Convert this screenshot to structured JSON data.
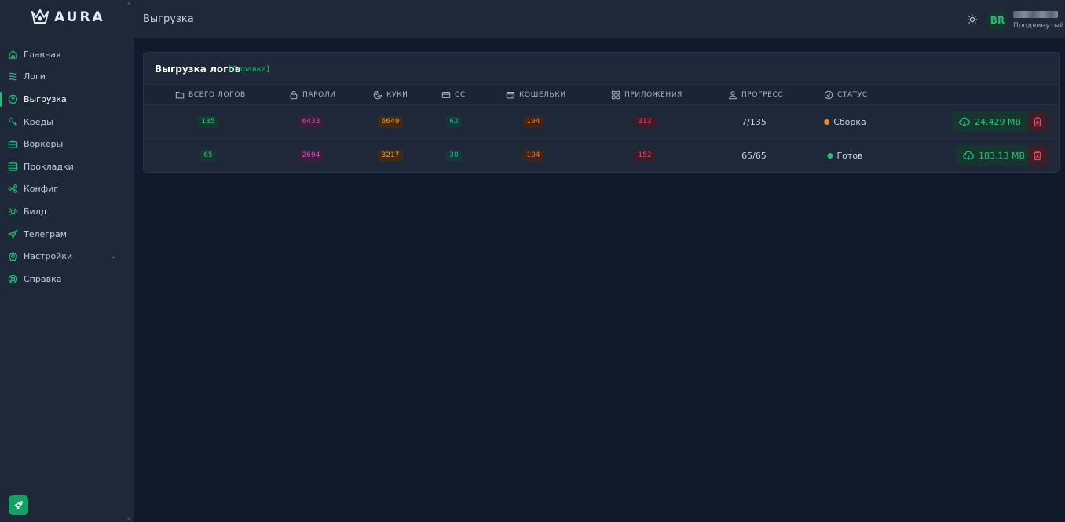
{
  "app": {
    "logo_text": "AURA"
  },
  "sidebar": {
    "items": [
      {
        "label": "Главная",
        "icon": "home-icon"
      },
      {
        "label": "Логи",
        "icon": "logs-icon"
      },
      {
        "label": "Выгрузка",
        "icon": "upload-icon",
        "active": true
      },
      {
        "label": "Креды",
        "icon": "key-icon"
      },
      {
        "label": "Воркеры",
        "icon": "briefcase-icon"
      },
      {
        "label": "Прокладки",
        "icon": "server-icon"
      },
      {
        "label": "Конфиг",
        "icon": "config-icon"
      },
      {
        "label": "Билд",
        "icon": "build-icon"
      },
      {
        "label": "Телеграм",
        "icon": "telegram-icon"
      },
      {
        "label": "Настройки",
        "icon": "settings-icon",
        "has_submenu": true
      },
      {
        "label": "Справка",
        "icon": "help-icon"
      }
    ]
  },
  "header": {
    "title": "Выгрузка",
    "avatar_initials": "BR",
    "user_role": "Продвинутый"
  },
  "card": {
    "title": "Выгрузка логов",
    "help_link": "[Справка]",
    "columns": [
      "ВСЕГО ЛОГОВ",
      "ПАРОЛИ",
      "КУКИ",
      "CC",
      "КОШЕЛЬКИ",
      "ПРИЛОЖЕНИЯ",
      "ПРОГРЕСС",
      "СТАТУС"
    ],
    "rows": [
      {
        "total": "135",
        "passwords": "6433",
        "cookies": "6649",
        "cc": "62",
        "wallets": "194",
        "apps": "313",
        "progress": "7/135",
        "status": "Сборка",
        "size": "24.429 MB"
      },
      {
        "total": "65",
        "passwords": "2694",
        "cookies": "3217",
        "cc": "30",
        "wallets": "104",
        "apps": "152",
        "progress": "65/65",
        "status": "Готов",
        "size": "183.13 MB"
      }
    ]
  },
  "colors": {
    "accent": "#1fbf75",
    "status_building": "#f08a24",
    "status_ready": "#1fbf75",
    "danger": "#ec4461"
  }
}
